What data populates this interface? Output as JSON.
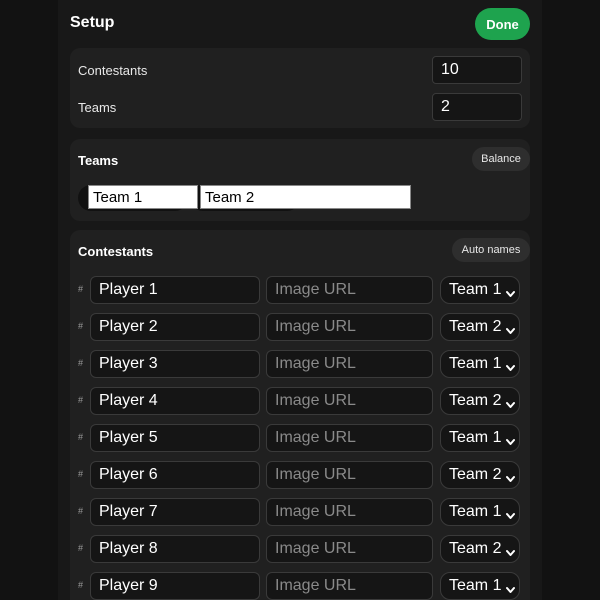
{
  "header": {
    "title": "Setup",
    "done_label": "Done"
  },
  "counts": {
    "contestants_label": "Contestants",
    "contestants_value": "10",
    "teams_label": "Teams",
    "teams_value": "2"
  },
  "teams": {
    "title": "Teams",
    "balance_label": "Balance",
    "names": [
      "Team 1",
      "Team 2"
    ]
  },
  "contestants": {
    "title": "Contestants",
    "auto_names_label": "Auto names",
    "hash_symbol": "#",
    "url_placeholder": "Image URL",
    "rows": [
      {
        "name": "Player 1",
        "team": "Team 1"
      },
      {
        "name": "Player 2",
        "team": "Team 2"
      },
      {
        "name": "Player 3",
        "team": "Team 1"
      },
      {
        "name": "Player 4",
        "team": "Team 2"
      },
      {
        "name": "Player 5",
        "team": "Team 1"
      },
      {
        "name": "Player 6",
        "team": "Team 2"
      },
      {
        "name": "Player 7",
        "team": "Team 1"
      },
      {
        "name": "Player 8",
        "team": "Team 2"
      },
      {
        "name": "Player 9",
        "team": "Team 1"
      }
    ]
  },
  "colors": {
    "accent": "#1ea34e",
    "background": "#121212",
    "card": "#202020"
  }
}
